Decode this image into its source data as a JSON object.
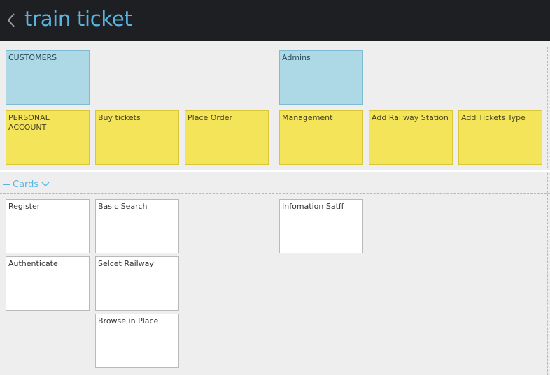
{
  "header": {
    "title": "train ticket",
    "back_icon": "chevron-left-icon"
  },
  "colors": {
    "header_bg": "#1e1f22",
    "accent": "#5ab4e0",
    "blue_card": "#add8e6",
    "yellow_card": "#f4e45a",
    "white_card": "#ffffff"
  },
  "board": {
    "roles": [
      {
        "label": "CUSTOMERS"
      },
      {
        "label": "Admins"
      }
    ],
    "activities": [
      {
        "label": "PERSONAL ACCOUNT"
      },
      {
        "label": "Buy tickets"
      },
      {
        "label": "Place Order"
      },
      {
        "label": "Management"
      },
      {
        "label": "Add Railway Station"
      },
      {
        "label": "Add Tickets Type"
      }
    ],
    "section": {
      "label": "Cards"
    },
    "stories": [
      {
        "label": "Register"
      },
      {
        "label": "Authenticate"
      },
      {
        "label": "Basic Search"
      },
      {
        "label": "Selcet Railway"
      },
      {
        "label": "Browse in Place"
      },
      {
        "label": "Infomation Satff"
      }
    ]
  }
}
